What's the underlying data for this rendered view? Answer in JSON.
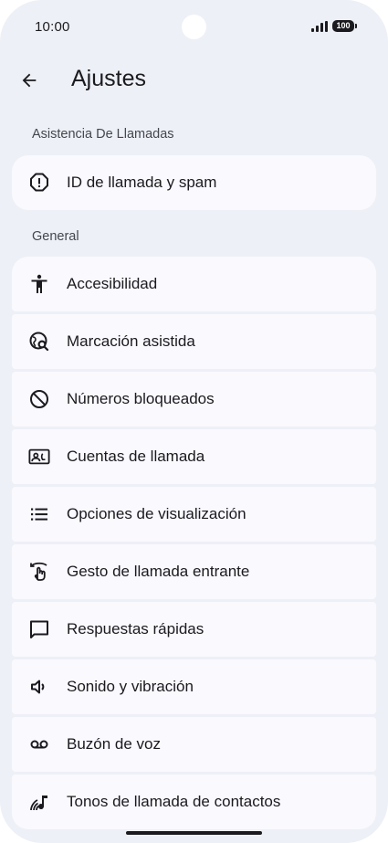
{
  "status_bar": {
    "time": "10:00",
    "battery": "100"
  },
  "header": {
    "title": "Ajustes"
  },
  "sections": [
    {
      "title": "Asistencia De Llamadas",
      "items": [
        {
          "label": "ID de llamada y spam",
          "icon": "spam-alert-icon"
        }
      ]
    },
    {
      "title": "General",
      "items": [
        {
          "label": "Accesibilidad",
          "icon": "accessibility-icon"
        },
        {
          "label": "Marcación asistida",
          "icon": "assisted-dialing-icon"
        },
        {
          "label": "Números bloqueados",
          "icon": "block-icon"
        },
        {
          "label": "Cuentas de llamada",
          "icon": "call-accounts-icon"
        },
        {
          "label": "Opciones de visualización",
          "icon": "list-icon"
        },
        {
          "label": "Gesto de llamada entrante",
          "icon": "swipe-gesture-icon"
        },
        {
          "label": "Respuestas rápidas",
          "icon": "message-icon"
        },
        {
          "label": "Sonido y vibración",
          "icon": "volume-icon"
        },
        {
          "label": "Buzón de voz",
          "icon": "voicemail-icon"
        },
        {
          "label": "Tonos de llamada de contactos",
          "icon": "ringtone-icon"
        }
      ]
    }
  ]
}
